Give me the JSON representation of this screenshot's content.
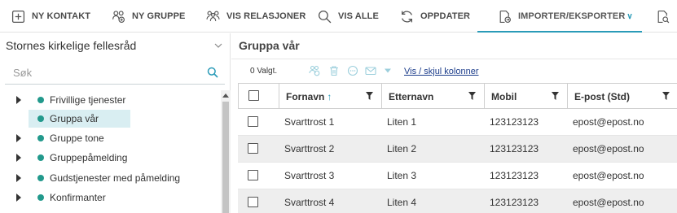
{
  "toolbar": {
    "items": [
      {
        "label": "NY KONTAKT",
        "icon": "plus-square-icon"
      },
      {
        "label": "NY GRUPPE",
        "icon": "add-group-icon"
      },
      {
        "label": "VIS RELASJONER",
        "icon": "relations-icon"
      },
      {
        "label": "VIS ALLE",
        "icon": "search-icon"
      },
      {
        "label": "OPPDATER",
        "icon": "refresh-icon"
      },
      {
        "label": "IMPORTER/EKSPORTER",
        "icon": "import-export-icon",
        "active": true
      },
      {
        "label": "",
        "icon": "document-search-icon"
      }
    ],
    "accent_color": "#2a9bb8"
  },
  "sidebar": {
    "organization": "Stornes kirkelige fellesråd",
    "search_placeholder": "Søk",
    "tree": [
      {
        "label": "Frivillige tjenester",
        "expandable": true,
        "selected": false
      },
      {
        "label": "Gruppa vår",
        "expandable": false,
        "selected": true
      },
      {
        "label": "Gruppe tone",
        "expandable": true,
        "selected": false
      },
      {
        "label": "Gruppepåmelding",
        "expandable": true,
        "selected": false
      },
      {
        "label": "Gudstjenester med påmelding",
        "expandable": true,
        "selected": false
      },
      {
        "label": "Konfirmanter",
        "expandable": true,
        "selected": false
      }
    ],
    "dot_color": "#22998c",
    "selected_color": "#d9eef2"
  },
  "main": {
    "title": "Gruppa vår",
    "selected_count": "0 Valgt.",
    "columns_link": "Vis / skjul kolonner",
    "table": {
      "columns": [
        "Fornavn",
        "Etternavn",
        "Mobil",
        "E-post (Std)"
      ],
      "sorted_column": "Fornavn",
      "sort_direction": "ascending",
      "rows": [
        [
          "Svarttrost 1",
          "Liten 1",
          "123123123",
          "epost@epost.no"
        ],
        [
          "Svarttrost 2",
          "Liten 2",
          "123123123",
          "epost@epost.no"
        ],
        [
          "Svarttrost 3",
          "Liten 3",
          "123123123",
          "epost@epost.no"
        ],
        [
          "Svarttrost 4",
          "Liten 4",
          "123123123",
          "epost@epost.no"
        ]
      ]
    }
  }
}
